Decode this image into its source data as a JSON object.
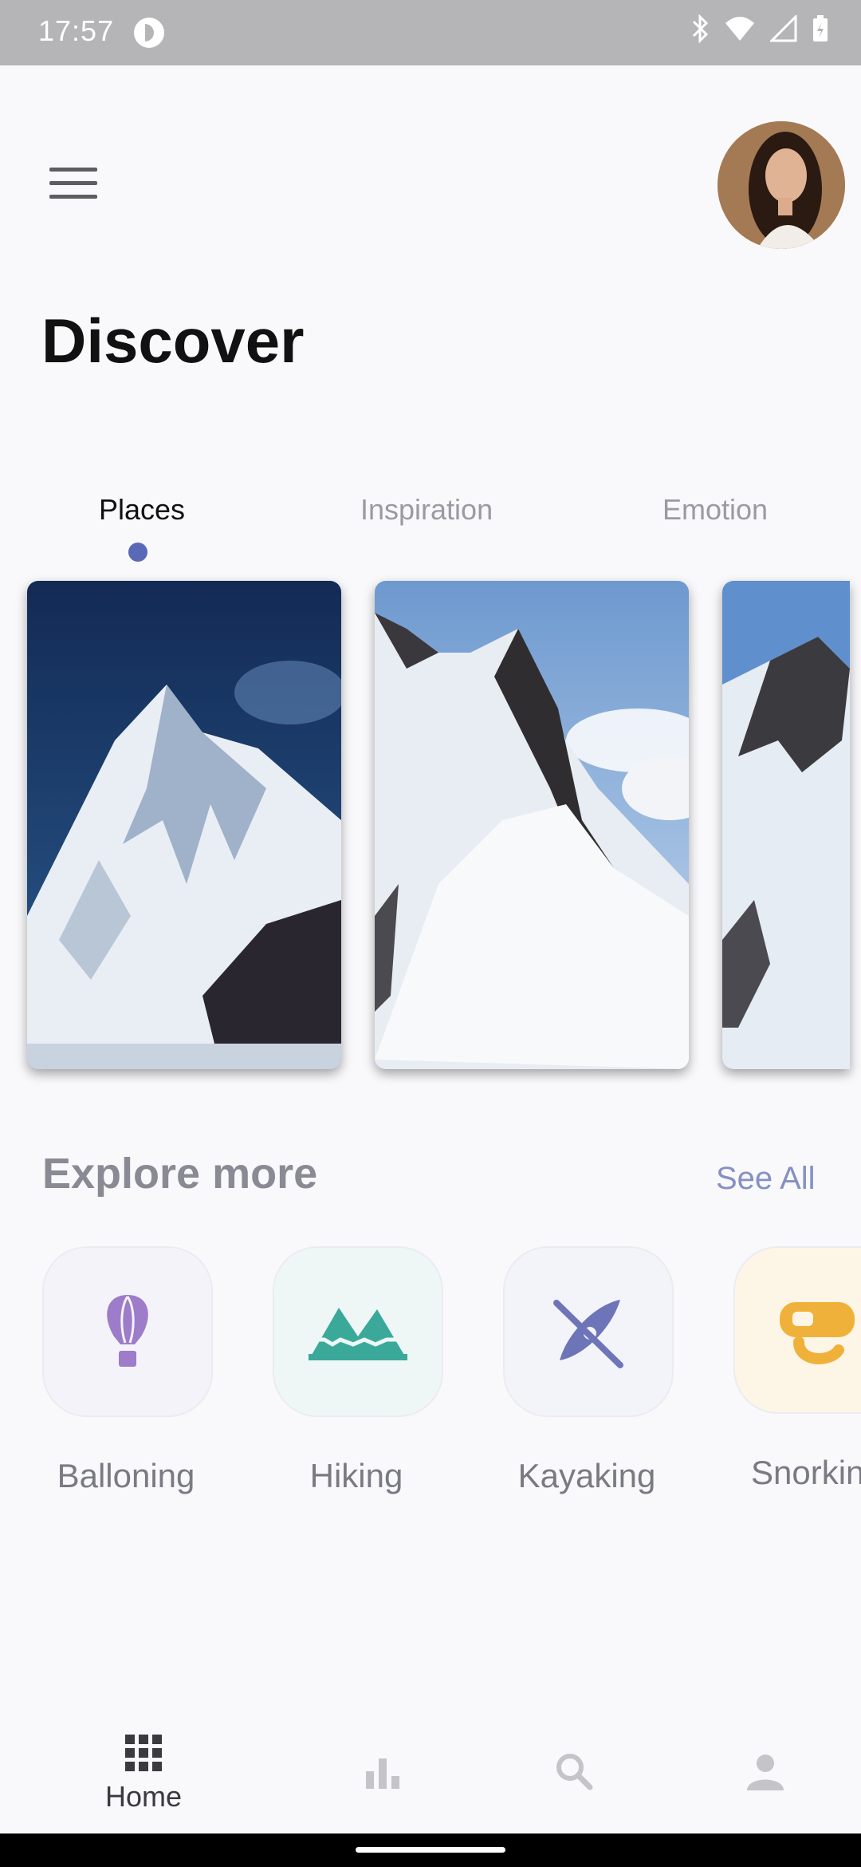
{
  "status_bar": {
    "time": "17:57"
  },
  "header": {
    "title": "Discover"
  },
  "tabs": [
    {
      "label": "Places",
      "active": true
    },
    {
      "label": "Inspiration",
      "active": false
    },
    {
      "label": "Emotion",
      "active": false
    }
  ],
  "explore": {
    "title": "Explore more",
    "see_all": "See All",
    "categories": [
      {
        "label": "Balloning",
        "icon": "hot-air-balloon-icon",
        "tile_color": "#f5f3fa",
        "icon_color": "#9d7cc9"
      },
      {
        "label": "Hiking",
        "icon": "mountains-icon",
        "tile_color": "#eef7f6",
        "icon_color": "#3aa99a"
      },
      {
        "label": "Kayaking",
        "icon": "kayak-icon",
        "tile_color": "#f3f4fa",
        "icon_color": "#6e74b8"
      },
      {
        "label": "Snorkin",
        "icon": "snorkel-mask-icon",
        "tile_color": "#fdf6e6",
        "icon_color": "#f0b13a"
      }
    ]
  },
  "bottom_nav": {
    "items": [
      {
        "label": "Home",
        "icon": "grid-icon",
        "active": true
      },
      {
        "label": "",
        "icon": "bar-chart-icon",
        "active": false
      },
      {
        "label": "",
        "icon": "search-icon",
        "active": false
      },
      {
        "label": "",
        "icon": "person-icon",
        "active": false
      }
    ]
  }
}
